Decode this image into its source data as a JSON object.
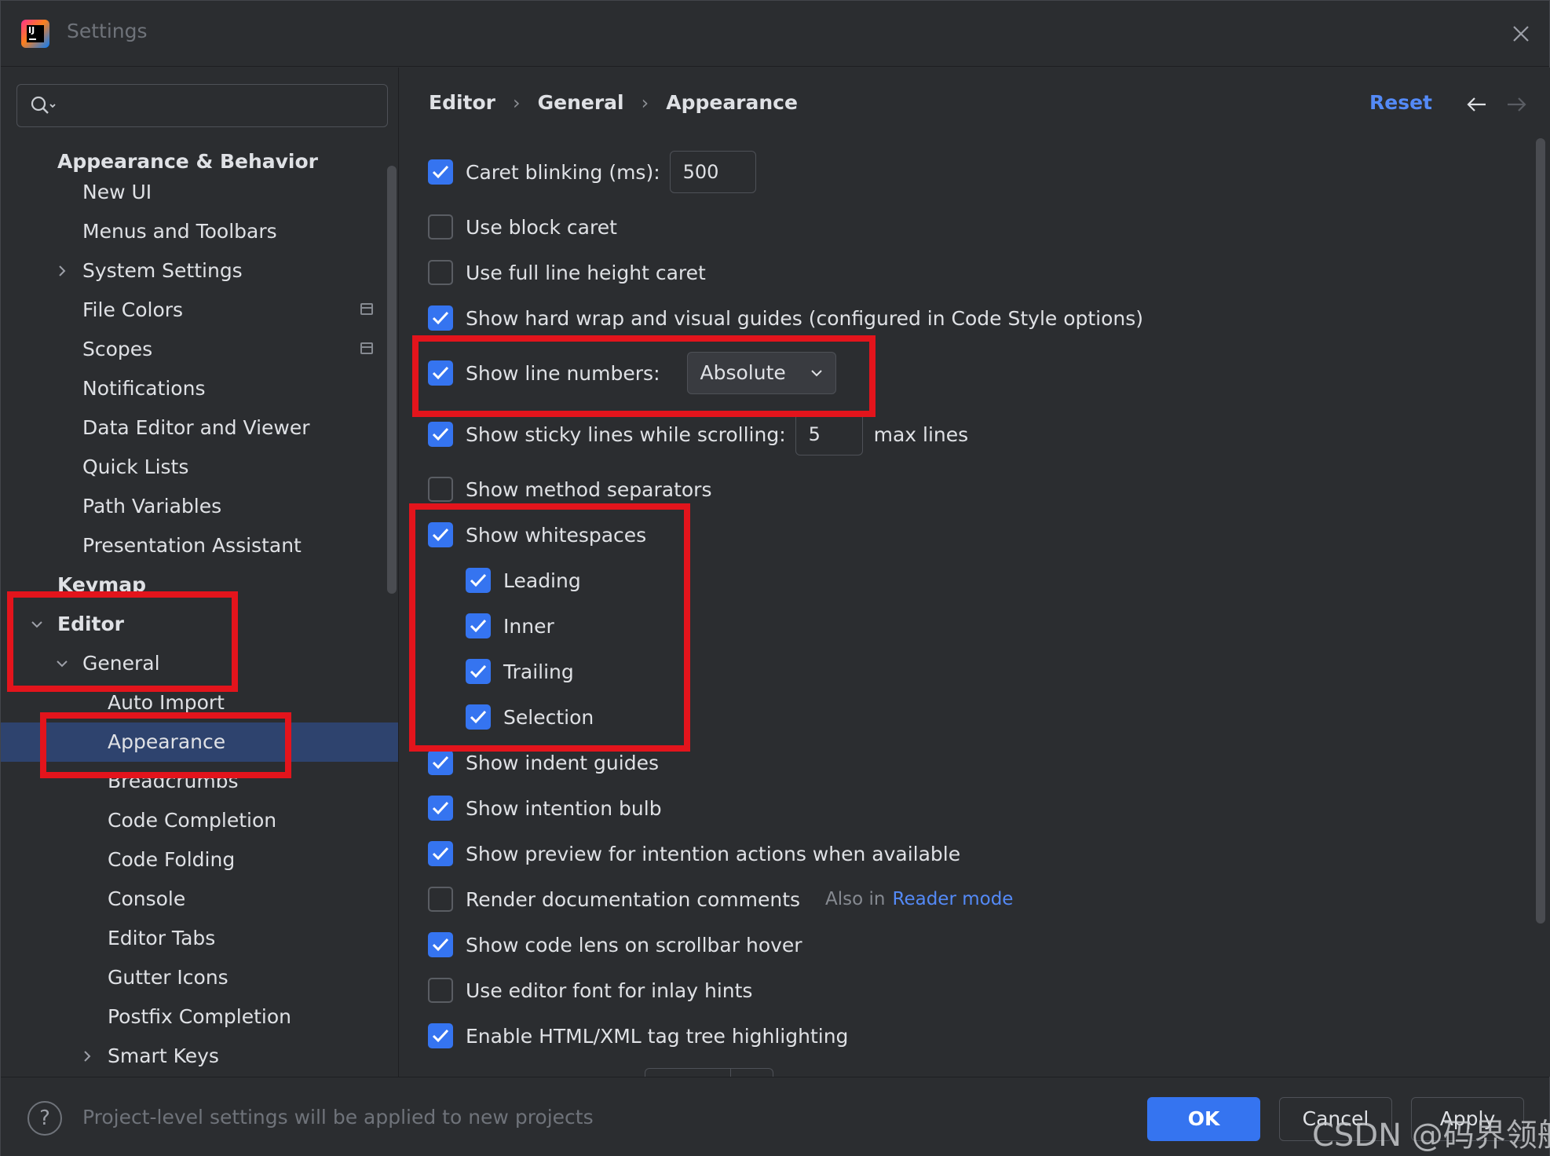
{
  "window": {
    "title": "Settings"
  },
  "sidebar": {
    "search_placeholder": "",
    "items": [
      {
        "label": "Appearance & Behavior"
      },
      {
        "label": "New UI"
      },
      {
        "label": "Menus and Toolbars"
      },
      {
        "label": "System Settings"
      },
      {
        "label": "File Colors"
      },
      {
        "label": "Scopes"
      },
      {
        "label": "Notifications"
      },
      {
        "label": "Data Editor and Viewer"
      },
      {
        "label": "Quick Lists"
      },
      {
        "label": "Path Variables"
      },
      {
        "label": "Presentation Assistant"
      },
      {
        "label": "Keymap"
      },
      {
        "label": "Editor"
      },
      {
        "label": "General"
      },
      {
        "label": "Auto Import"
      },
      {
        "label": "Appearance"
      },
      {
        "label": "Breadcrumbs"
      },
      {
        "label": "Code Completion"
      },
      {
        "label": "Code Folding"
      },
      {
        "label": "Console"
      },
      {
        "label": "Editor Tabs"
      },
      {
        "label": "Gutter Icons"
      },
      {
        "label": "Postfix Completion"
      },
      {
        "label": "Smart Keys"
      }
    ]
  },
  "breadcrumb": {
    "items": [
      "Editor",
      "General",
      "Appearance"
    ],
    "separator": "›"
  },
  "header": {
    "reset_label": "Reset"
  },
  "options": {
    "caret_blinking": {
      "label": "Caret blinking (ms):",
      "checked": true,
      "value": "500"
    },
    "block_caret": {
      "label": "Use block caret",
      "checked": false
    },
    "full_line_caret": {
      "label": "Use full line height caret",
      "checked": false
    },
    "hard_wrap": {
      "label": "Show hard wrap and visual guides (configured in Code Style options)",
      "checked": true
    },
    "line_numbers": {
      "label": "Show line numbers:",
      "checked": true,
      "selected": "Absolute"
    },
    "sticky_lines": {
      "label": "Show sticky lines while scrolling:",
      "checked": true,
      "value": "5",
      "suffix": "max lines"
    },
    "method_separators": {
      "label": "Show method separators",
      "checked": false
    },
    "whitespaces": {
      "label": "Show whitespaces",
      "checked": true
    },
    "leading": {
      "label": "Leading",
      "checked": true
    },
    "inner": {
      "label": "Inner",
      "checked": true
    },
    "trailing": {
      "label": "Trailing",
      "checked": true
    },
    "selection": {
      "label": "Selection",
      "checked": true
    },
    "indent_guides": {
      "label": "Show indent guides",
      "checked": true
    },
    "intention_bulb": {
      "label": "Show intention bulb",
      "checked": true
    },
    "intention_preview": {
      "label": "Show preview for intention actions when available",
      "checked": true
    },
    "render_docs": {
      "label": "Render documentation comments",
      "checked": false,
      "also_in": "Also in",
      "link": "Reader mode"
    },
    "code_lens": {
      "label": "Show code lens on scrollbar hover",
      "checked": true
    },
    "inlay_font": {
      "label": "Use editor font for inlay hints",
      "checked": false
    },
    "tag_tree": {
      "label": "Enable HTML/XML tag tree highlighting",
      "checked": true
    }
  },
  "footer": {
    "help_label": "?",
    "hint": "Project-level settings will be applied to new projects",
    "ok_label": "OK",
    "cancel_label": "Cancel",
    "apply_label": "Apply"
  },
  "watermark": "CSDN @码界领航",
  "colors": {
    "accent": "#3574f0",
    "highlight_box": "#e3141c",
    "selection": "#2e436e",
    "link": "#548af7"
  }
}
